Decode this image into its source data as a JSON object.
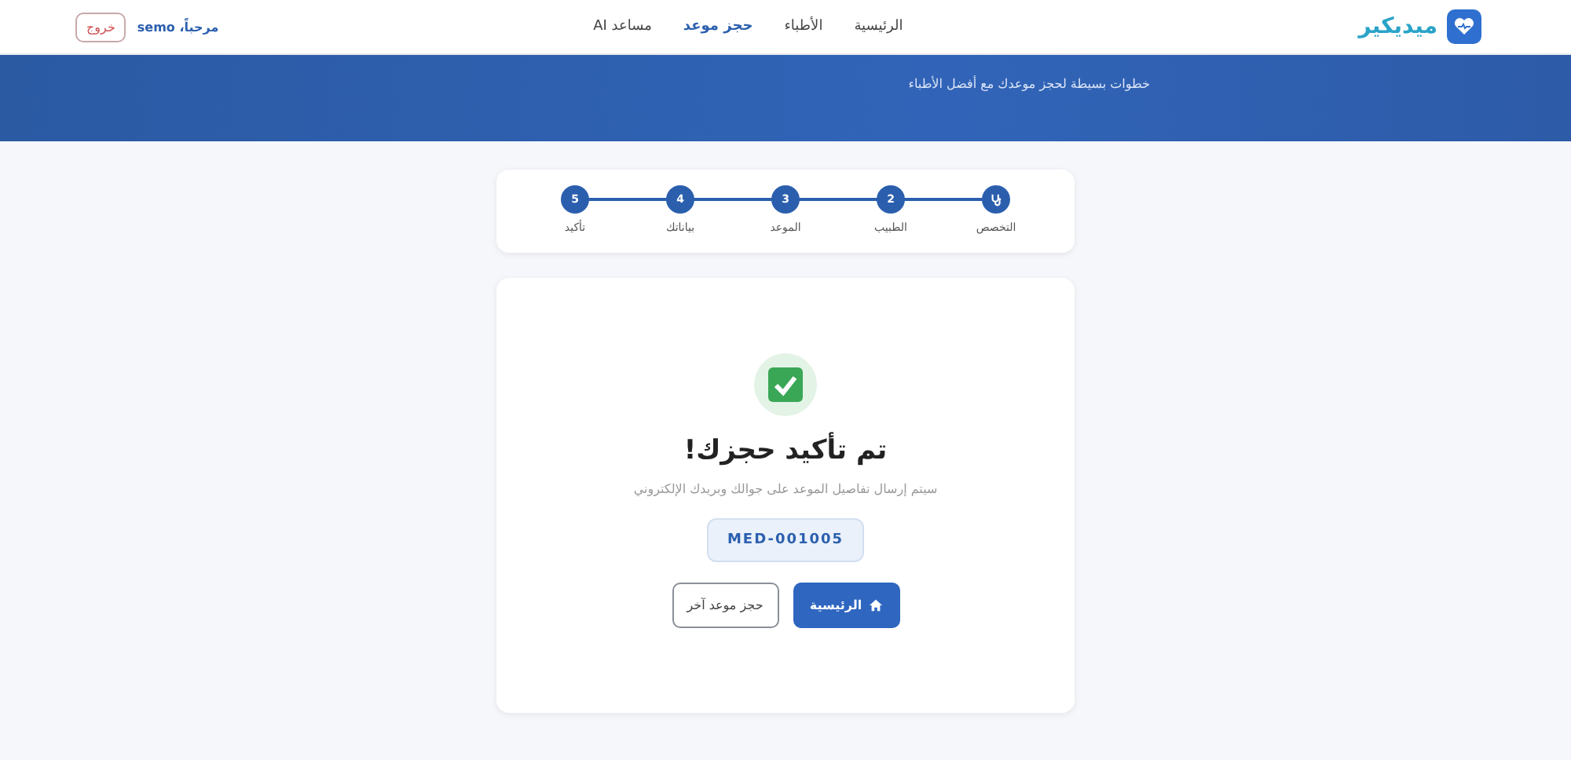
{
  "brand": {
    "name": "ميديكير"
  },
  "nav": [
    {
      "label": "الرئيسية",
      "selected": false
    },
    {
      "label": "الأطباء",
      "selected": false
    },
    {
      "label": "حجز موعد",
      "selected": true
    },
    {
      "label": "مساعد AI",
      "selected": false
    }
  ],
  "user": {
    "greeting": "مرحباً، semo",
    "logout": "خروج"
  },
  "hero": {
    "subtitle": "خطوات بسيطة لحجز موعدك مع أفضل الأطباء"
  },
  "steps": [
    {
      "kind": "icon",
      "label": "التخصص",
      "done": true
    },
    {
      "kind": "number",
      "number": "2",
      "label": "الطبيب",
      "done": true
    },
    {
      "kind": "number",
      "number": "3",
      "label": "الموعد",
      "done": true
    },
    {
      "kind": "number",
      "number": "4",
      "label": "بياناتك",
      "done": true
    },
    {
      "kind": "number",
      "number": "5",
      "label": "تأكيد",
      "done": true
    }
  ],
  "confirmation": {
    "title": "تم تأكيد حجزك!",
    "message": "سيتم إرسال تفاصيل الموعد على جوالك وبريدك الإلكتروني",
    "code": "MED-001005",
    "buttons": [
      {
        "kind": "primary",
        "label": "الرئيسية"
      },
      {
        "kind": "secondary",
        "label": "حجز موعد آخر"
      }
    ]
  }
}
